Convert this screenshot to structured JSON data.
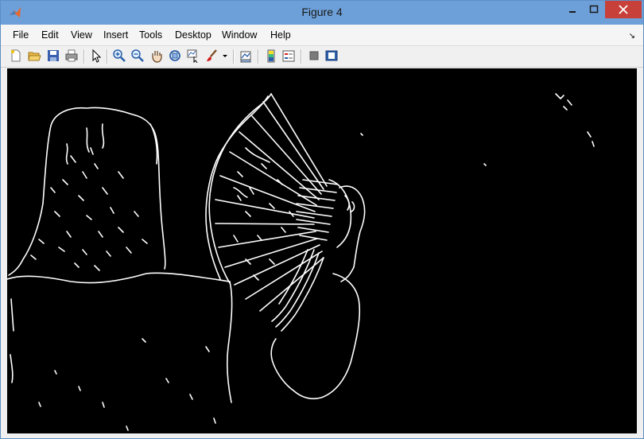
{
  "window": {
    "title": "Figure 4"
  },
  "menu": [
    "File",
    "Edit",
    "View",
    "Insert",
    "Tools",
    "Desktop",
    "Window",
    "Help"
  ],
  "toolbar_icons": [
    "new-figure-icon",
    "open-file-icon",
    "save-icon",
    "print-icon",
    "select-arrow-icon",
    "zoom-in-icon",
    "zoom-out-icon",
    "pan-hand-icon",
    "rotate-3d-icon",
    "data-cursor-icon",
    "brush-icon",
    "brush-dropdown-icon",
    "link-plot-icon",
    "colorbar-icon",
    "legend-icon",
    "hide-plot-tools-icon",
    "show-plot-tools-icon"
  ],
  "colors": {
    "titlebar": "#6da0d8",
    "close": "#c7413a",
    "canvas": "#000000",
    "edges": "#ffffff"
  }
}
